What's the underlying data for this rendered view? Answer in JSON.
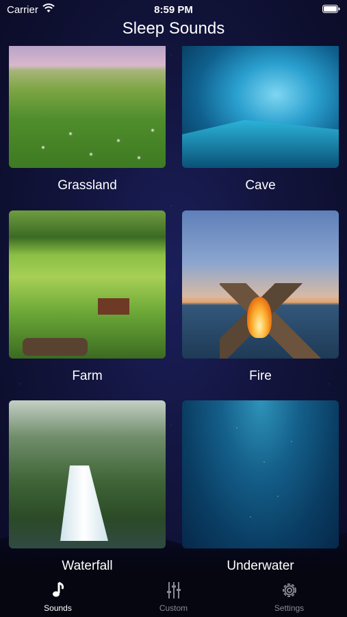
{
  "status_bar": {
    "carrier": "Carrier",
    "time": "8:59 PM"
  },
  "nav": {
    "title": "Sleep Sounds"
  },
  "sounds": [
    {
      "label": "Grassland"
    },
    {
      "label": "Cave"
    },
    {
      "label": "Farm"
    },
    {
      "label": "Fire"
    },
    {
      "label": "Waterfall"
    },
    {
      "label": "Underwater"
    }
  ],
  "tabs": [
    {
      "label": "Sounds",
      "icon": "music-note-icon",
      "active": true
    },
    {
      "label": "Custom",
      "icon": "sliders-icon",
      "active": false
    },
    {
      "label": "Settings",
      "icon": "gear-icon",
      "active": false
    }
  ],
  "colors": {
    "background": "#12143c",
    "tab_active": "#ffffff",
    "tab_inactive": "#8a8a92"
  }
}
